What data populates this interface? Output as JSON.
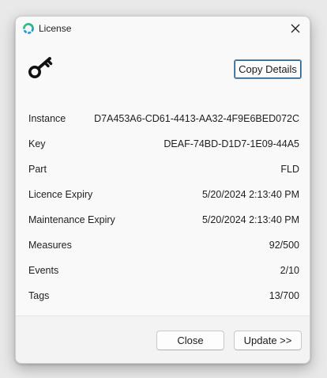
{
  "window": {
    "title": "License",
    "app_icon": "app-ring-icon",
    "close_icon": "close-icon"
  },
  "header": {
    "icon": "key-icon",
    "copy_button_label": "Copy Details"
  },
  "details": [
    {
      "label": "Instance",
      "value": "D7A453A6-CD61-4413-AA32-4F9E6BED072C"
    },
    {
      "label": "Key",
      "value": "DEAF-74BD-D1D7-1E09-44A5"
    },
    {
      "label": "Part",
      "value": "FLD"
    },
    {
      "label": "Licence Expiry",
      "value": "5/20/2024 2:13:40 PM"
    },
    {
      "label": "Maintenance Expiry",
      "value": "5/20/2024 2:13:40 PM"
    },
    {
      "label": "Measures",
      "value": "92/500"
    },
    {
      "label": "Events",
      "value": "2/10"
    },
    {
      "label": "Tags",
      "value": "13/700"
    }
  ],
  "footer": {
    "close_label": "Close",
    "update_label": "Update >>"
  },
  "colors": {
    "accent": "#0067c0",
    "app_icon_green": "#2fb58a",
    "app_icon_blue": "#1c9bd8"
  }
}
